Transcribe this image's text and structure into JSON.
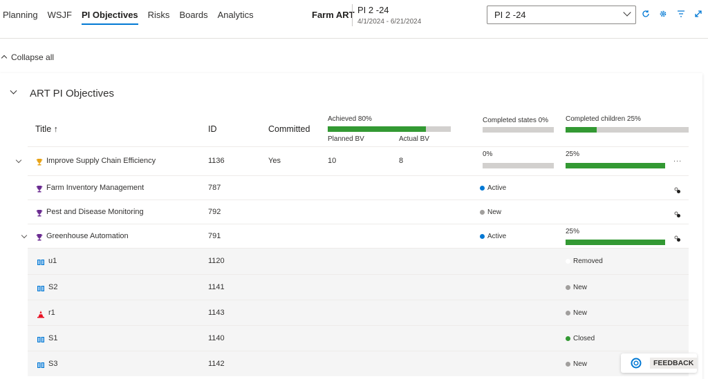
{
  "nav": {
    "tabs": [
      {
        "label": "Planning",
        "active": false
      },
      {
        "label": "WSJF",
        "active": false
      },
      {
        "label": "PI Objectives",
        "active": true
      },
      {
        "label": "Risks",
        "active": false
      },
      {
        "label": "Boards",
        "active": false
      },
      {
        "label": "Analytics",
        "active": false
      }
    ]
  },
  "header": {
    "art_name": "Farm ART",
    "pi_name": "PI 2 -24",
    "pi_dates": "4/1/2024 - 6/21/2024",
    "pi_select_value": "PI 2 -24"
  },
  "collapse_all": "Collapse all",
  "section": {
    "title": "ART PI Objectives",
    "columns": {
      "title": "Title ↑",
      "id": "ID",
      "committed": "Committed",
      "achieved": "Achieved 80%",
      "planned_bv": "Planned BV",
      "actual_bv": "Actual BV",
      "completed_states": "Completed states 0%",
      "completed_children": "Completed children 25%"
    },
    "header_progress": {
      "achieved": 0.8,
      "completed_states": 0.0,
      "completed_children": 0.25
    }
  },
  "rows": [
    {
      "title": "Improve Supply Chain Efficiency",
      "id": "1136",
      "committed": "Yes",
      "planned_bv": "10",
      "actual_bv": "8",
      "states_pct": "0%",
      "states_val": 0.0,
      "children_pct": "25%",
      "children_val": 0.25,
      "icon": "trophy-gold-icon",
      "more": "...",
      "expandable": true
    },
    {
      "title": "Farm Inventory Management",
      "id": "787",
      "state": "Active",
      "state_color": "#0078d4",
      "icon": "trophy-purple-icon"
    },
    {
      "title": "Pest and Disease Monitoring",
      "id": "792",
      "state": "New",
      "state_color": "#a19f9d",
      "icon": "trophy-purple-icon"
    },
    {
      "title": "Greenhouse Automation",
      "id": "791",
      "state": "Active",
      "state_color": "#0078d4",
      "children_pct": "25%",
      "children_val": 0.25,
      "icon": "trophy-purple-icon",
      "expandable": true
    },
    {
      "title": "u1",
      "id": "1120",
      "state": "Removed",
      "state_color": "#ffffff",
      "icon": "book-icon"
    },
    {
      "title": "S2",
      "id": "1141",
      "state": "New",
      "state_color": "#a19f9d",
      "icon": "book-icon"
    },
    {
      "title": "r1",
      "id": "1143",
      "state": "New",
      "state_color": "#a19f9d",
      "icon": "risk-cone-icon"
    },
    {
      "title": "S1",
      "id": "1140",
      "state": "Closed",
      "state_color": "#339933",
      "icon": "book-icon"
    },
    {
      "title": "S3",
      "id": "1142",
      "state": "New",
      "state_color": "#a19f9d",
      "icon": "book-icon"
    }
  ],
  "feedback": {
    "label": "FEEDBACK"
  },
  "colors": {
    "accent": "#0078d4",
    "progress": "#339933",
    "track": "#d2d0ce"
  }
}
